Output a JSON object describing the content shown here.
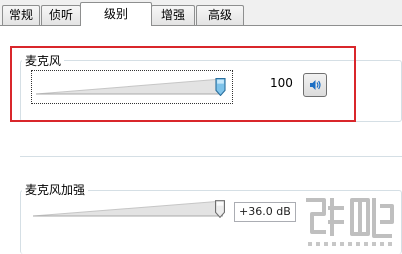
{
  "tabs": [
    {
      "label": "常规",
      "active": false
    },
    {
      "label": "侦听",
      "active": false
    },
    {
      "label": "级别",
      "active": true
    },
    {
      "label": "增强",
      "active": false
    },
    {
      "label": "高级",
      "active": false
    }
  ],
  "microphone": {
    "title": "麦克风",
    "level_value": "100",
    "level_fraction": 1.0,
    "mute_icon": "speaker-icon"
  },
  "boost": {
    "title": "麦克风加强",
    "value_text": "+36.0 dB",
    "level_fraction": 1.0
  },
  "colors": {
    "highlight": "#d9262b",
    "thumb": "#7ec3ea",
    "accent": "#1c6fc4"
  }
}
